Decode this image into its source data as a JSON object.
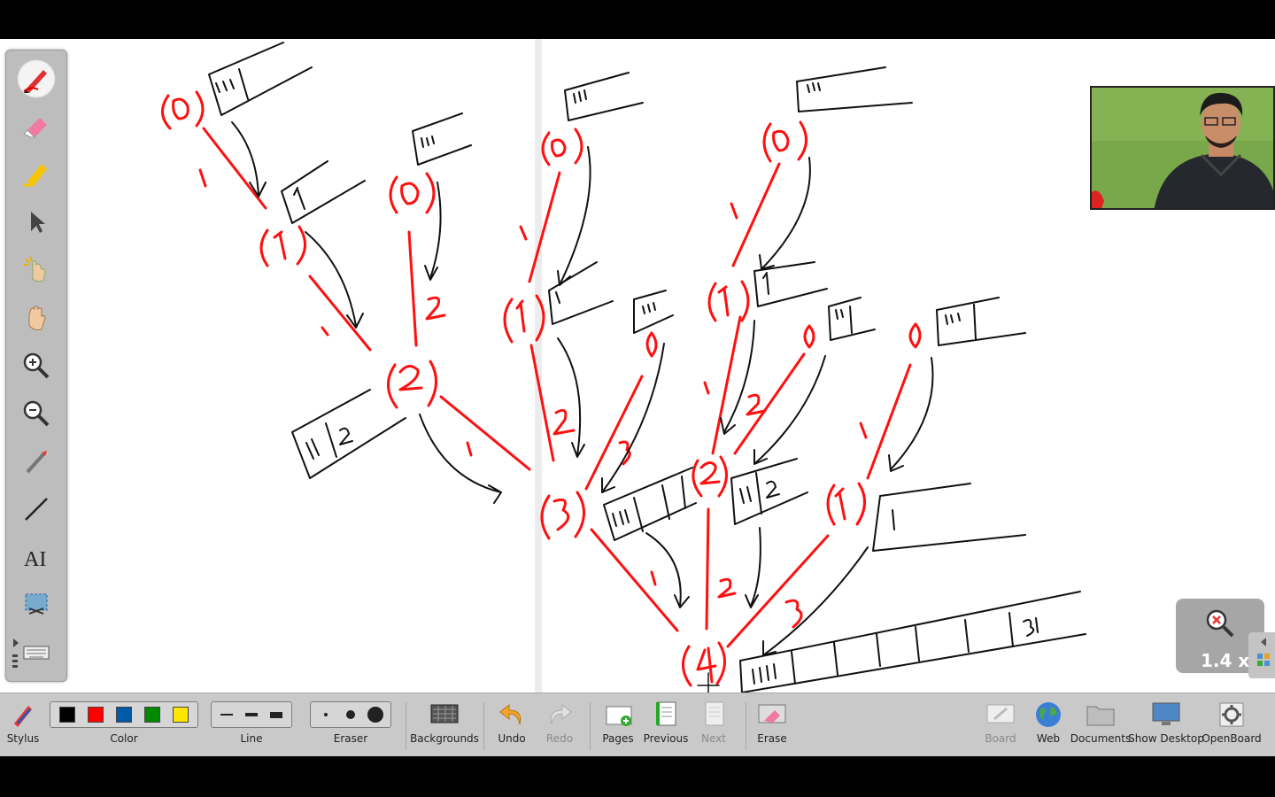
{
  "sidebar": {
    "tools": [
      {
        "name": "pen-tool",
        "icon": "pen-icon",
        "active": true
      },
      {
        "name": "eraser-tool",
        "icon": "eraser-icon",
        "active": false
      },
      {
        "name": "highlighter-tool",
        "icon": "highlighter-icon",
        "active": false
      },
      {
        "name": "selector-tool",
        "icon": "arrow-pointer-icon",
        "active": false
      },
      {
        "name": "interact-tool",
        "icon": "hand-click-icon",
        "active": false
      },
      {
        "name": "pan-tool",
        "icon": "hand-icon",
        "active": false
      },
      {
        "name": "zoom-in-tool",
        "icon": "zoom-in-icon",
        "active": false
      },
      {
        "name": "zoom-out-tool",
        "icon": "zoom-out-icon",
        "active": false
      },
      {
        "name": "laser-tool",
        "icon": "laser-pointer-icon",
        "active": false
      },
      {
        "name": "line-tool",
        "icon": "line-icon",
        "active": false
      },
      {
        "name": "text-tool",
        "icon": "text-icon",
        "label": "AI",
        "active": false
      },
      {
        "name": "capture-tool",
        "icon": "capture-icon",
        "active": false
      },
      {
        "name": "keyboard-tool",
        "icon": "keyboard-icon",
        "active": false
      }
    ]
  },
  "toolbar": {
    "stylus_label": "Stylus",
    "color_label": "Color",
    "colors": [
      "#000000",
      "#ff0000",
      "#005aa8",
      "#008a00",
      "#ffe600"
    ],
    "line_label": "Line",
    "eraser_label": "Eraser",
    "backgrounds_label": "Backgrounds",
    "undo_label": "Undo",
    "redo_label": "Redo",
    "pages_label": "Pages",
    "previous_label": "Previous",
    "next_label": "Next",
    "erase_label": "Erase",
    "board_label": "Board",
    "web_label": "Web",
    "documents_label": "Documents",
    "show_desktop_label": "Show Desktop",
    "openboard_label": "OpenBoard"
  },
  "zoom": {
    "level": "1.4 x"
  },
  "canvas": {
    "ink_colors": {
      "red": "#ff1010",
      "black": "#111111"
    },
    "red_labels": [
      "(0)",
      "(0)",
      "(0)",
      "(0)",
      "(1)",
      "(1)",
      "(1)",
      "(2)",
      "(2)",
      "(3)",
      "(1)",
      "(4)",
      "0",
      "0",
      "0",
      "1",
      "1",
      "1",
      "1",
      "1",
      "1",
      "1",
      "2",
      "2",
      "2",
      "2",
      "2",
      "3",
      "3"
    ],
    "box_texts": [
      "111",
      "1",
      "111",
      "111",
      "1",
      "111",
      "1",
      "111",
      "111",
      "11",
      "2",
      "111",
      "12",
      "21",
      "3",
      "11",
      "2",
      "1",
      "1111",
      "112",
      "121",
      "13",
      "211",
      "22",
      "31"
    ]
  }
}
